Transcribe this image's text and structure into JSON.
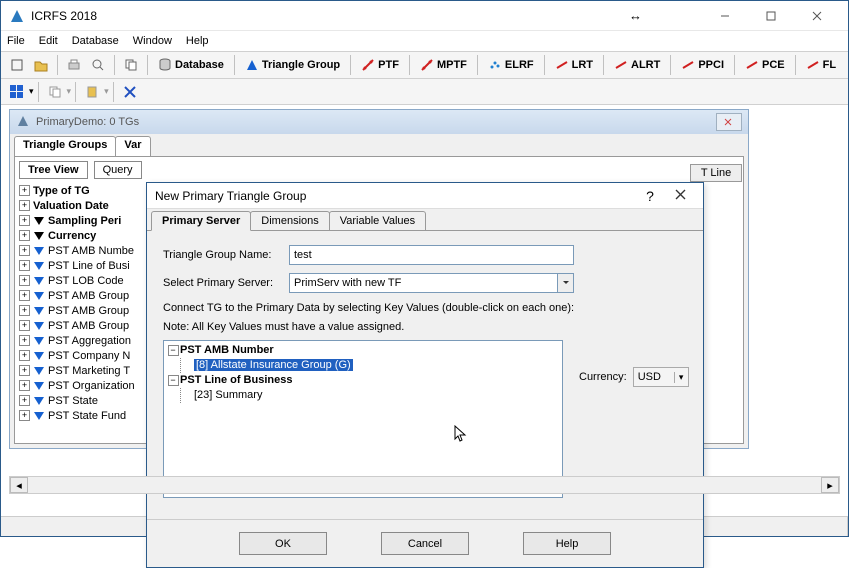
{
  "window": {
    "title": "ICRFS 2018"
  },
  "menu": [
    "File",
    "Edit",
    "Database",
    "Window",
    "Help"
  ],
  "toolbar_labels": {
    "database": "Database",
    "triangle_group": "Triangle Group",
    "ptf": "PTF",
    "mptf": "MPTF",
    "elrf": "ELRF",
    "lrt": "LRT",
    "alrt": "ALRT",
    "ppci": "PPCI",
    "pce": "PCE",
    "fl": "FL"
  },
  "mdi": {
    "title": "PrimaryDemo: 0 TGs",
    "tabs": [
      "Triangle Groups",
      "Var"
    ],
    "viewtabs": [
      "Tree View",
      "Query"
    ],
    "tline": "T Line",
    "tree": [
      {
        "label": "Type of TG",
        "bold": true
      },
      {
        "label": "Valuation Date",
        "bold": true
      },
      {
        "label": "Sampling Peri",
        "bold": true
      },
      {
        "label": "Currency",
        "bold": true
      },
      {
        "label": "PST AMB Numbe",
        "tri": "blue"
      },
      {
        "label": "PST Line of Busi",
        "tri": "blue"
      },
      {
        "label": "PST LOB Code",
        "tri": "blue"
      },
      {
        "label": "PST AMB Group",
        "tri": "blue"
      },
      {
        "label": "PST AMB Group",
        "tri": "blue"
      },
      {
        "label": "PST AMB Group",
        "tri": "blue"
      },
      {
        "label": "PST Aggregation",
        "tri": "blue"
      },
      {
        "label": "PST Company N",
        "tri": "blue"
      },
      {
        "label": "PST Marketing T",
        "tri": "blue"
      },
      {
        "label": "PST Organization",
        "tri": "blue"
      },
      {
        "label": "PST State",
        "tri": "blue"
      },
      {
        "label": "PST State Fund",
        "tri": "blue"
      }
    ]
  },
  "dialog": {
    "title": "New Primary Triangle Group",
    "tabs": [
      "Primary Server",
      "Dimensions",
      "Variable Values"
    ],
    "tg_name_label": "Triangle Group Name:",
    "tg_name_value": "test",
    "server_label": "Select Primary Server:",
    "server_value": "PrimServ with new TF",
    "note1": "Connect TG to the Primary Data by selecting Key Values (double-click on each one):",
    "note2": "Note: All Key Values must have a value assigned.",
    "key_tree": {
      "n1": "PST AMB Number",
      "n1_child": "[8] Allstate Insurance Group (G)",
      "n2": "PST Line of Business",
      "n2_child": "[23] Summary"
    },
    "currency_label": "Currency:",
    "currency_value": "USD",
    "buttons": {
      "ok": "OK",
      "cancel": "Cancel",
      "help": "Help"
    }
  }
}
